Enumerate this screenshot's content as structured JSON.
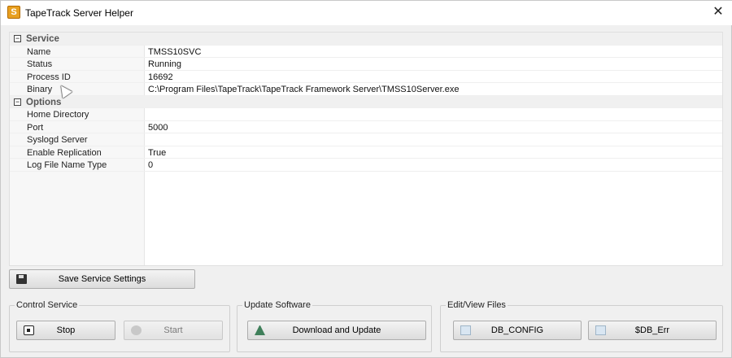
{
  "window": {
    "title": "TapeTrack Server Helper",
    "close_glyph": "✕",
    "app_icon_letter": "S"
  },
  "grid": {
    "rows": [
      {
        "type": "category",
        "label": "Service",
        "toggle": "−"
      },
      {
        "type": "prop",
        "label": "Name",
        "value": "TMSS10SVC"
      },
      {
        "type": "prop",
        "label": "Status",
        "value": "Running"
      },
      {
        "type": "prop",
        "label": "Process ID",
        "value": "16692"
      },
      {
        "type": "prop",
        "label": "Binary",
        "value": "C:\\Program Files\\TapeTrack\\TapeTrack Framework Server\\TMSS10Server.exe"
      },
      {
        "type": "category",
        "label": "Options",
        "toggle": "−"
      },
      {
        "type": "prop",
        "label": "Home Directory",
        "value": ""
      },
      {
        "type": "prop",
        "label": "Port",
        "value": "5000"
      },
      {
        "type": "prop",
        "label": "Syslogd Server",
        "value": ""
      },
      {
        "type": "prop",
        "label": "Enable Replication",
        "value": "True"
      },
      {
        "type": "prop",
        "label": "Log File Name Type",
        "value": "0"
      }
    ]
  },
  "actions": {
    "save_label": "Save Service Settings"
  },
  "control_service": {
    "legend": "Control Service",
    "stop_label": "Stop",
    "start_label": "Start"
  },
  "update_software": {
    "legend": "Update Software",
    "download_label": "Download and Update"
  },
  "edit_view_files": {
    "legend": "Edit/View Files",
    "db_config_label": "DB_CONFIG",
    "db_err_label": "$DB_Err"
  },
  "icons": {
    "app": "app-icon",
    "close": "close-icon",
    "toggle": "minus-square-icon",
    "save": "floppy-disk-icon",
    "stop": "stop-icon",
    "start": "start-icon",
    "update": "tree-icon",
    "file": "file-icon",
    "cursor": "mouse-pointer-icon"
  },
  "colors": {
    "background": "#f0f0f0",
    "grid_background": "#ffffff",
    "category_text": "#555555"
  }
}
